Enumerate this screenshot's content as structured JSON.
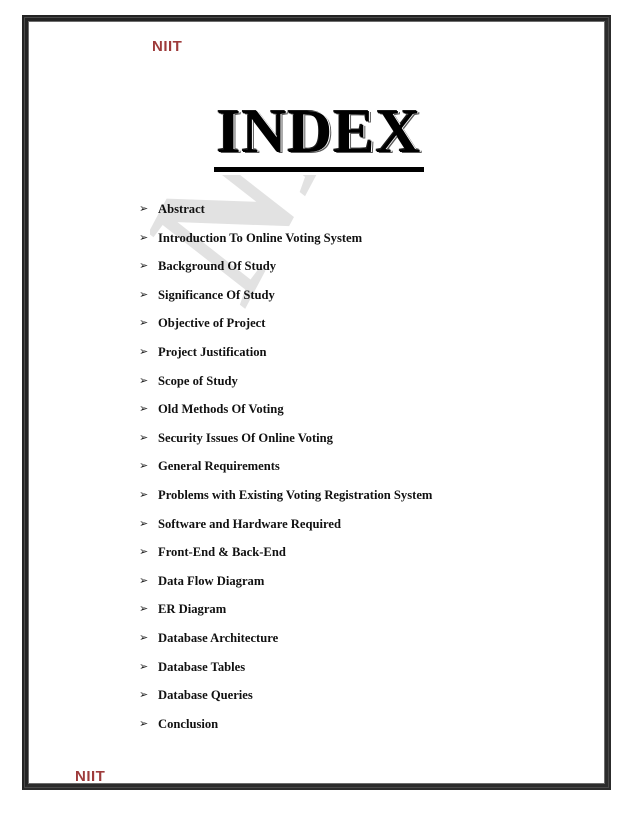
{
  "document": {
    "header_brand": "NIIT",
    "footer_brand": "NIIT",
    "title": "INDEX",
    "watermark_text": "NITIN",
    "brand_color": "#9e3b3b",
    "text_color": "#111111",
    "border_color": "#232323",
    "watermark_color": "#e2e2e2",
    "bullet_glyph": "➢"
  },
  "index_items": [
    {
      "label": "Abstract"
    },
    {
      "label": "Introduction To Online Voting System"
    },
    {
      "label": "Background Of Study"
    },
    {
      "label": "Significance Of Study"
    },
    {
      "label": "Objective of Project"
    },
    {
      "label": "Project Justification"
    },
    {
      "label": "Scope of Study"
    },
    {
      "label": "Old Methods Of Voting"
    },
    {
      "label": "Security Issues Of Online Voting"
    },
    {
      "label": "General Requirements"
    },
    {
      "label": "Problems with Existing Voting Registration System"
    },
    {
      "label": "Software and Hardware Required"
    },
    {
      "label": "Front-End & Back-End"
    },
    {
      "label": "Data Flow Diagram"
    },
    {
      "label": "ER Diagram"
    },
    {
      "label": "Database Architecture"
    },
    {
      "label": "Database Tables"
    },
    {
      "label": "Database Queries"
    },
    {
      "label": "Conclusion"
    }
  ]
}
